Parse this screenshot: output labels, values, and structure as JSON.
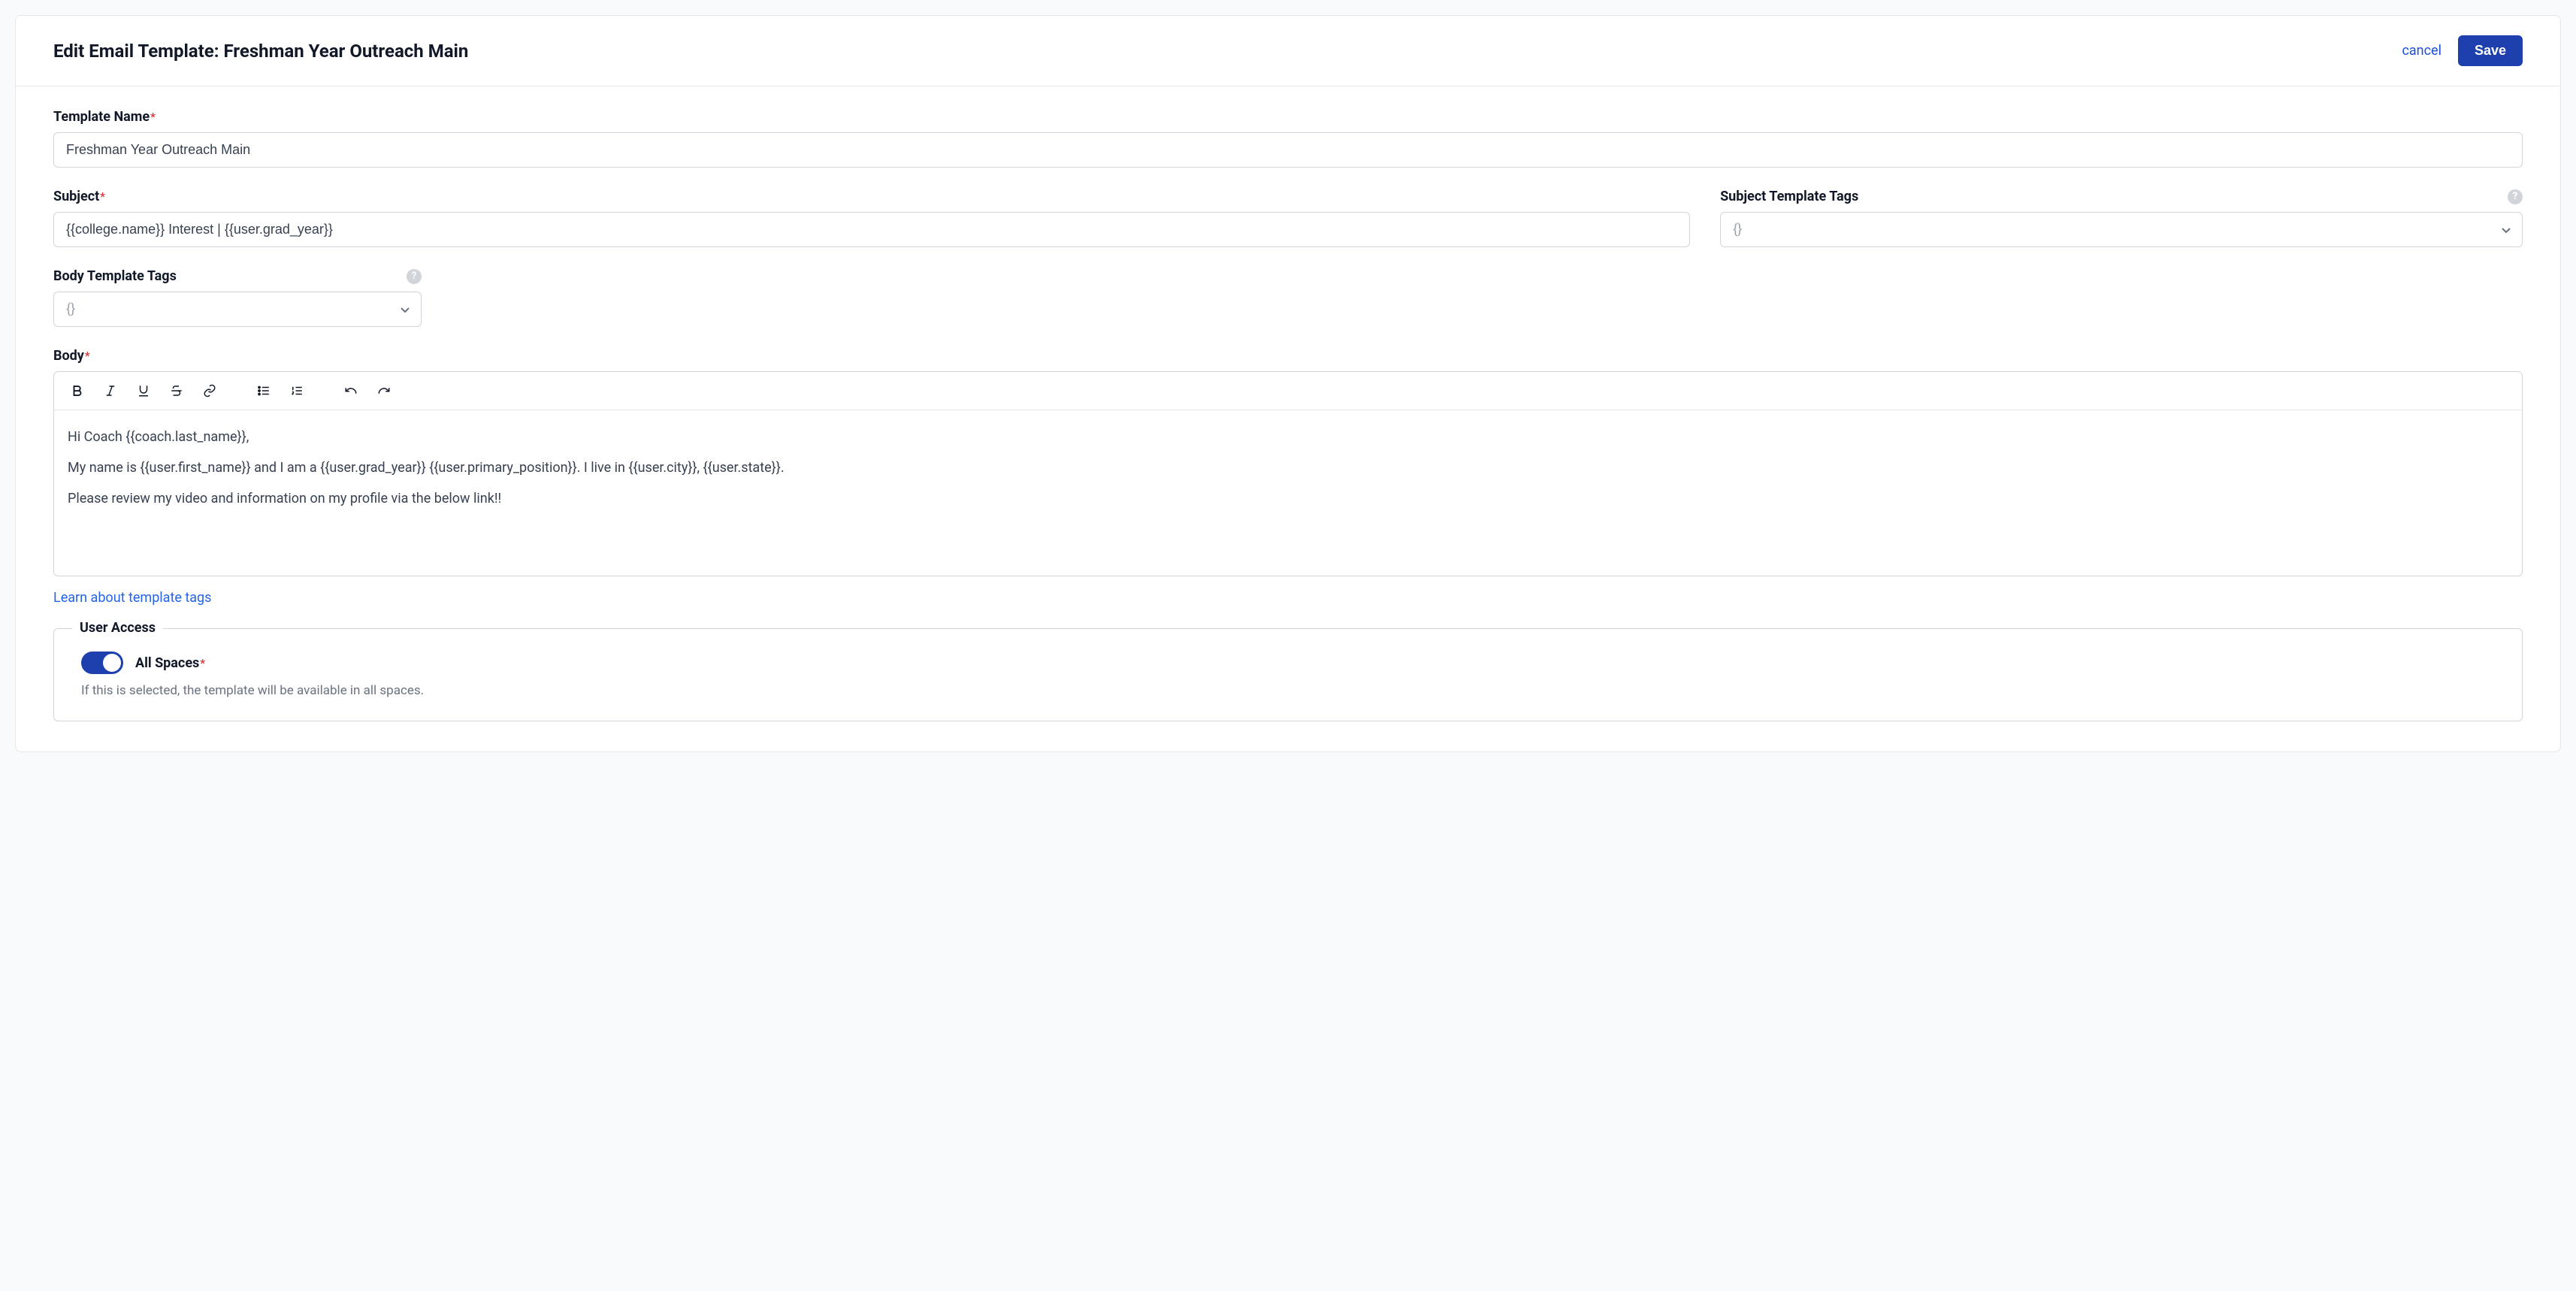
{
  "header": {
    "title": "Edit Email Template: Freshman Year Outreach Main",
    "cancel_label": "cancel",
    "save_label": "Save"
  },
  "fields": {
    "template_name": {
      "label": "Template Name",
      "value": "Freshman Year Outreach Main"
    },
    "subject": {
      "label": "Subject",
      "value": "{{college.name}} Interest | {{user.grad_year}}"
    },
    "subject_tags": {
      "label": "Subject Template Tags",
      "placeholder": "{}"
    },
    "body_tags": {
      "label": "Body Template Tags",
      "placeholder": "{}"
    },
    "body": {
      "label": "Body",
      "paragraphs": [
        "Hi Coach {{coach.last_name}},",
        "My name is {{user.first_name}} and I am a  {{user.grad_year}} {{user.primary_position}}. I live in {{user.city}}, {{user.state}}.",
        "Please review my video and information on my profile via the below link!!"
      ]
    },
    "learn_link": "Learn about template tags"
  },
  "user_access": {
    "legend": "User Access",
    "all_spaces_label": "All Spaces",
    "all_spaces_on": true,
    "helper": "If this is selected, the template will be available in all spaces."
  }
}
